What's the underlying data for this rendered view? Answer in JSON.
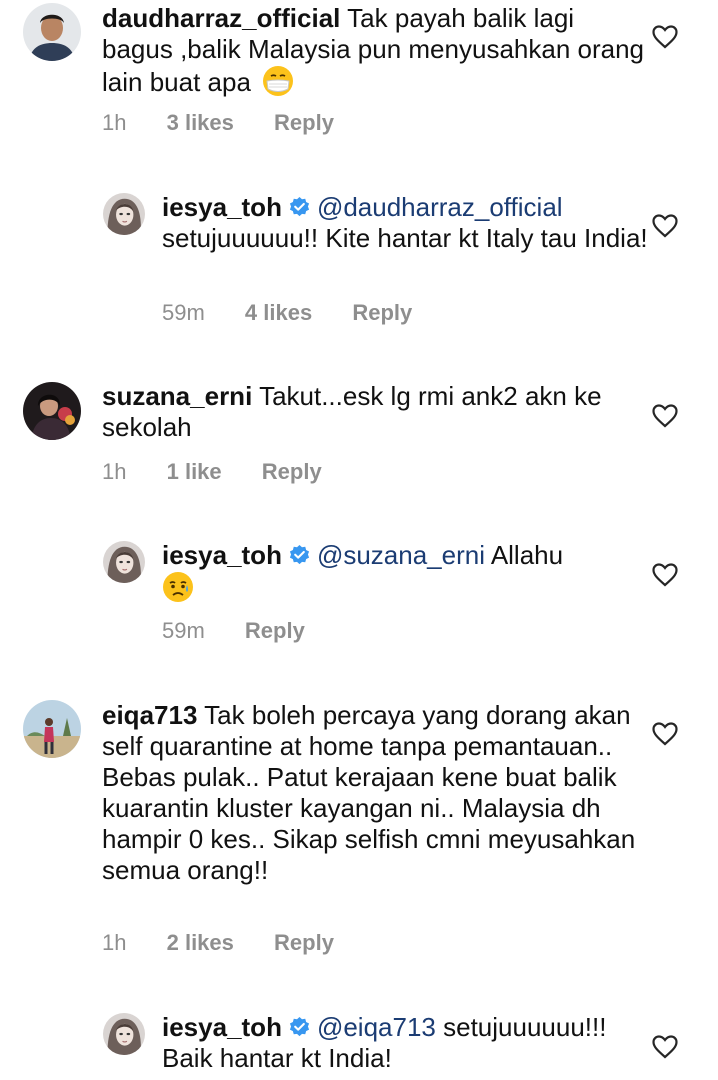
{
  "comments": [
    {
      "username": "daudharraz_official",
      "text": "Tak payah balik lagi bagus ,balik Malaysia pun menyusahkan orang lain buat apa",
      "emoji": "face-with-medical-mask-emoji",
      "time": "1h",
      "likes": "3 likes",
      "reply_label": "Reply"
    },
    {
      "username": "iesya_toh",
      "verified": true,
      "mention": "@daudharraz_official",
      "text": "setujuuuuuu!! Kite hantar kt Italy tau India!",
      "time": "59m",
      "likes": "4 likes",
      "reply_label": "Reply"
    },
    {
      "username": "suzana_erni",
      "text": "Takut...esk lg rmi ank2 akn ke sekolah",
      "time": "1h",
      "likes": "1 like",
      "reply_label": "Reply"
    },
    {
      "username": "iesya_toh",
      "verified": true,
      "mention": "@suzana_erni",
      "text": "Allahu",
      "emoji": "sad-but-relieved-face-emoji",
      "time": "59m",
      "reply_label": "Reply"
    },
    {
      "username": "eiqa713",
      "text": "Tak boleh percaya yang dorang akan self quarantine at home tanpa pemantauan.. Bebas pulak.. Patut kerajaan kene buat balik kuarantin kluster kayangan ni.. Malaysia dh hampir 0 kes.. Sikap selfish cmni meyusahkan semua orang!!",
      "time": "1h",
      "likes": "2 likes",
      "reply_label": "Reply"
    },
    {
      "username": "iesya_toh",
      "verified": true,
      "mention": "@eiqa713",
      "text": "setujuuuuuu!!! Baik hantar kt India!"
    }
  ],
  "icons": {
    "like": "heart-outline-icon",
    "verified": "verified-badge-icon"
  },
  "colors": {
    "mention": "#1b3c73",
    "meta": "#8e8e8e",
    "verified": "#3897f0"
  }
}
